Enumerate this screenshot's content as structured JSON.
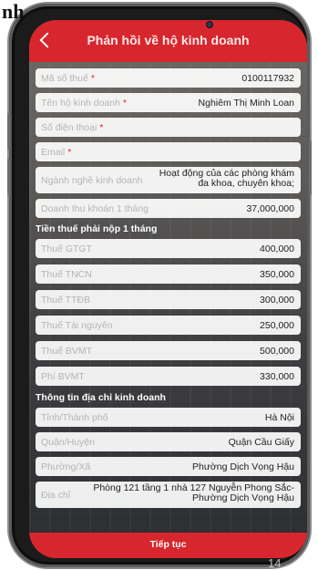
{
  "corner_text": "nh",
  "page_number": "14",
  "header": {
    "title": "Phản hồi về hộ kinh doanh"
  },
  "fields": {
    "tax_code": {
      "label": "Mã số thuế",
      "required_mark": "*",
      "value": "0100117932"
    },
    "business_name": {
      "label": "Tên hộ kinh doanh",
      "required_mark": "*",
      "value": "Nghiêm Thị Minh Loan"
    },
    "phone": {
      "label": "Số điện thoại",
      "required_mark": "*",
      "value": ""
    },
    "email": {
      "label": "Email",
      "required_mark": "*",
      "value": ""
    },
    "industry": {
      "label": "Ngành nghề kinh doanh",
      "value": "Hoạt động của các phòng khám đa khoa, chuyên khoa;"
    },
    "revenue": {
      "label": "Doanh thu khoán 1 tháng",
      "value": "37,000,000"
    }
  },
  "tax_section": {
    "title": "Tiền thuế phải nộp 1 tháng",
    "items": [
      {
        "label": "Thuế GTGT",
        "value": "400,000"
      },
      {
        "label": "Thuế TNCN",
        "value": "350,000"
      },
      {
        "label": "Thuế TTĐB",
        "value": "300,000"
      },
      {
        "label": "Thuế Tài nguyên",
        "value": "250,000"
      },
      {
        "label": "Thuế BVMT",
        "value": "500,000"
      },
      {
        "label": "Phí BVMT",
        "value": "330,000"
      }
    ]
  },
  "address_section": {
    "title": "Thông tin địa chỉ kinh doanh",
    "province": {
      "label": "Tỉnh/Thành phố",
      "value": "Hà Nội"
    },
    "district": {
      "label": "Quận/Huyện",
      "value": "Quận Cầu Giấy"
    },
    "ward": {
      "label": "Phường/Xã",
      "value": "Phường Dịch Vọng Hậu"
    },
    "address": {
      "label": "Địa chỉ",
      "value": "Phòng 121 tầng 1 nhà 127 Nguyễn Phong Sắc-Phường Dịch Vọng Hậu"
    }
  },
  "continue_button": {
    "label": "Tiếp tục"
  },
  "colors": {
    "accent": "#d7262d",
    "field_bg": "#ffffff",
    "label": "#b4b4b4"
  }
}
